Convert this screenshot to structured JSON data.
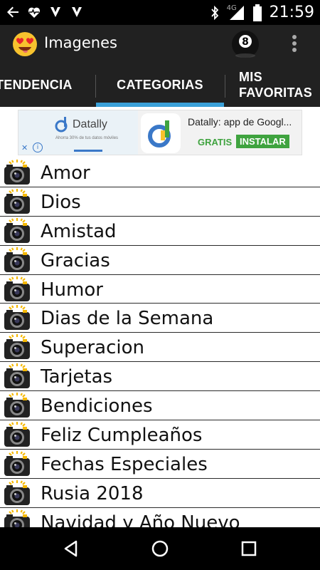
{
  "statusbar": {
    "time": "21:59",
    "network": "4G",
    "icons_left": [
      "back-arrow-icon",
      "heart-monitor-icon",
      "app-notification-icon",
      "app-notification-icon"
    ],
    "icons_right": [
      "bluetooth-icon",
      "signal-icon",
      "battery-icon"
    ]
  },
  "appbar": {
    "title": "Imagenes",
    "icon": "heart-eyes-emoji-icon",
    "action_icon": "magic-8-ball-icon",
    "menu_icon": "more-vert-icon"
  },
  "tabs": {
    "items": [
      {
        "label": "TENDENCIA"
      },
      {
        "label": "CATEGORIAS",
        "selected": true
      },
      {
        "label_line1": "MIS",
        "label_line2": "FAVORITAS"
      }
    ],
    "indicator_color": "#3aa0d8"
  },
  "ad": {
    "brand": "Datally",
    "small_text": "Ahorra 30% de tus datos móviles",
    "title": "Datally: app de Googl...",
    "price": "GRATIS",
    "install": "INSTALAR",
    "close": "✕",
    "info": "i",
    "accent": "#3fa33f"
  },
  "categories": [
    {
      "label": "Amor"
    },
    {
      "label": "Dios"
    },
    {
      "label": "Amistad"
    },
    {
      "label": "Gracias"
    },
    {
      "label": "Humor"
    },
    {
      "label": "Dias de la Semana"
    },
    {
      "label": "Superacion"
    },
    {
      "label": "Tarjetas"
    },
    {
      "label": "Bendiciones"
    },
    {
      "label": "Feliz Cumpleaños"
    },
    {
      "label": "Fechas Especiales"
    },
    {
      "label": "Rusia 2018"
    },
    {
      "label": "Navidad y Año Nuevo"
    }
  ],
  "navbar": {
    "icons": [
      "back-triangle-icon",
      "home-circle-icon",
      "recents-square-icon"
    ]
  }
}
